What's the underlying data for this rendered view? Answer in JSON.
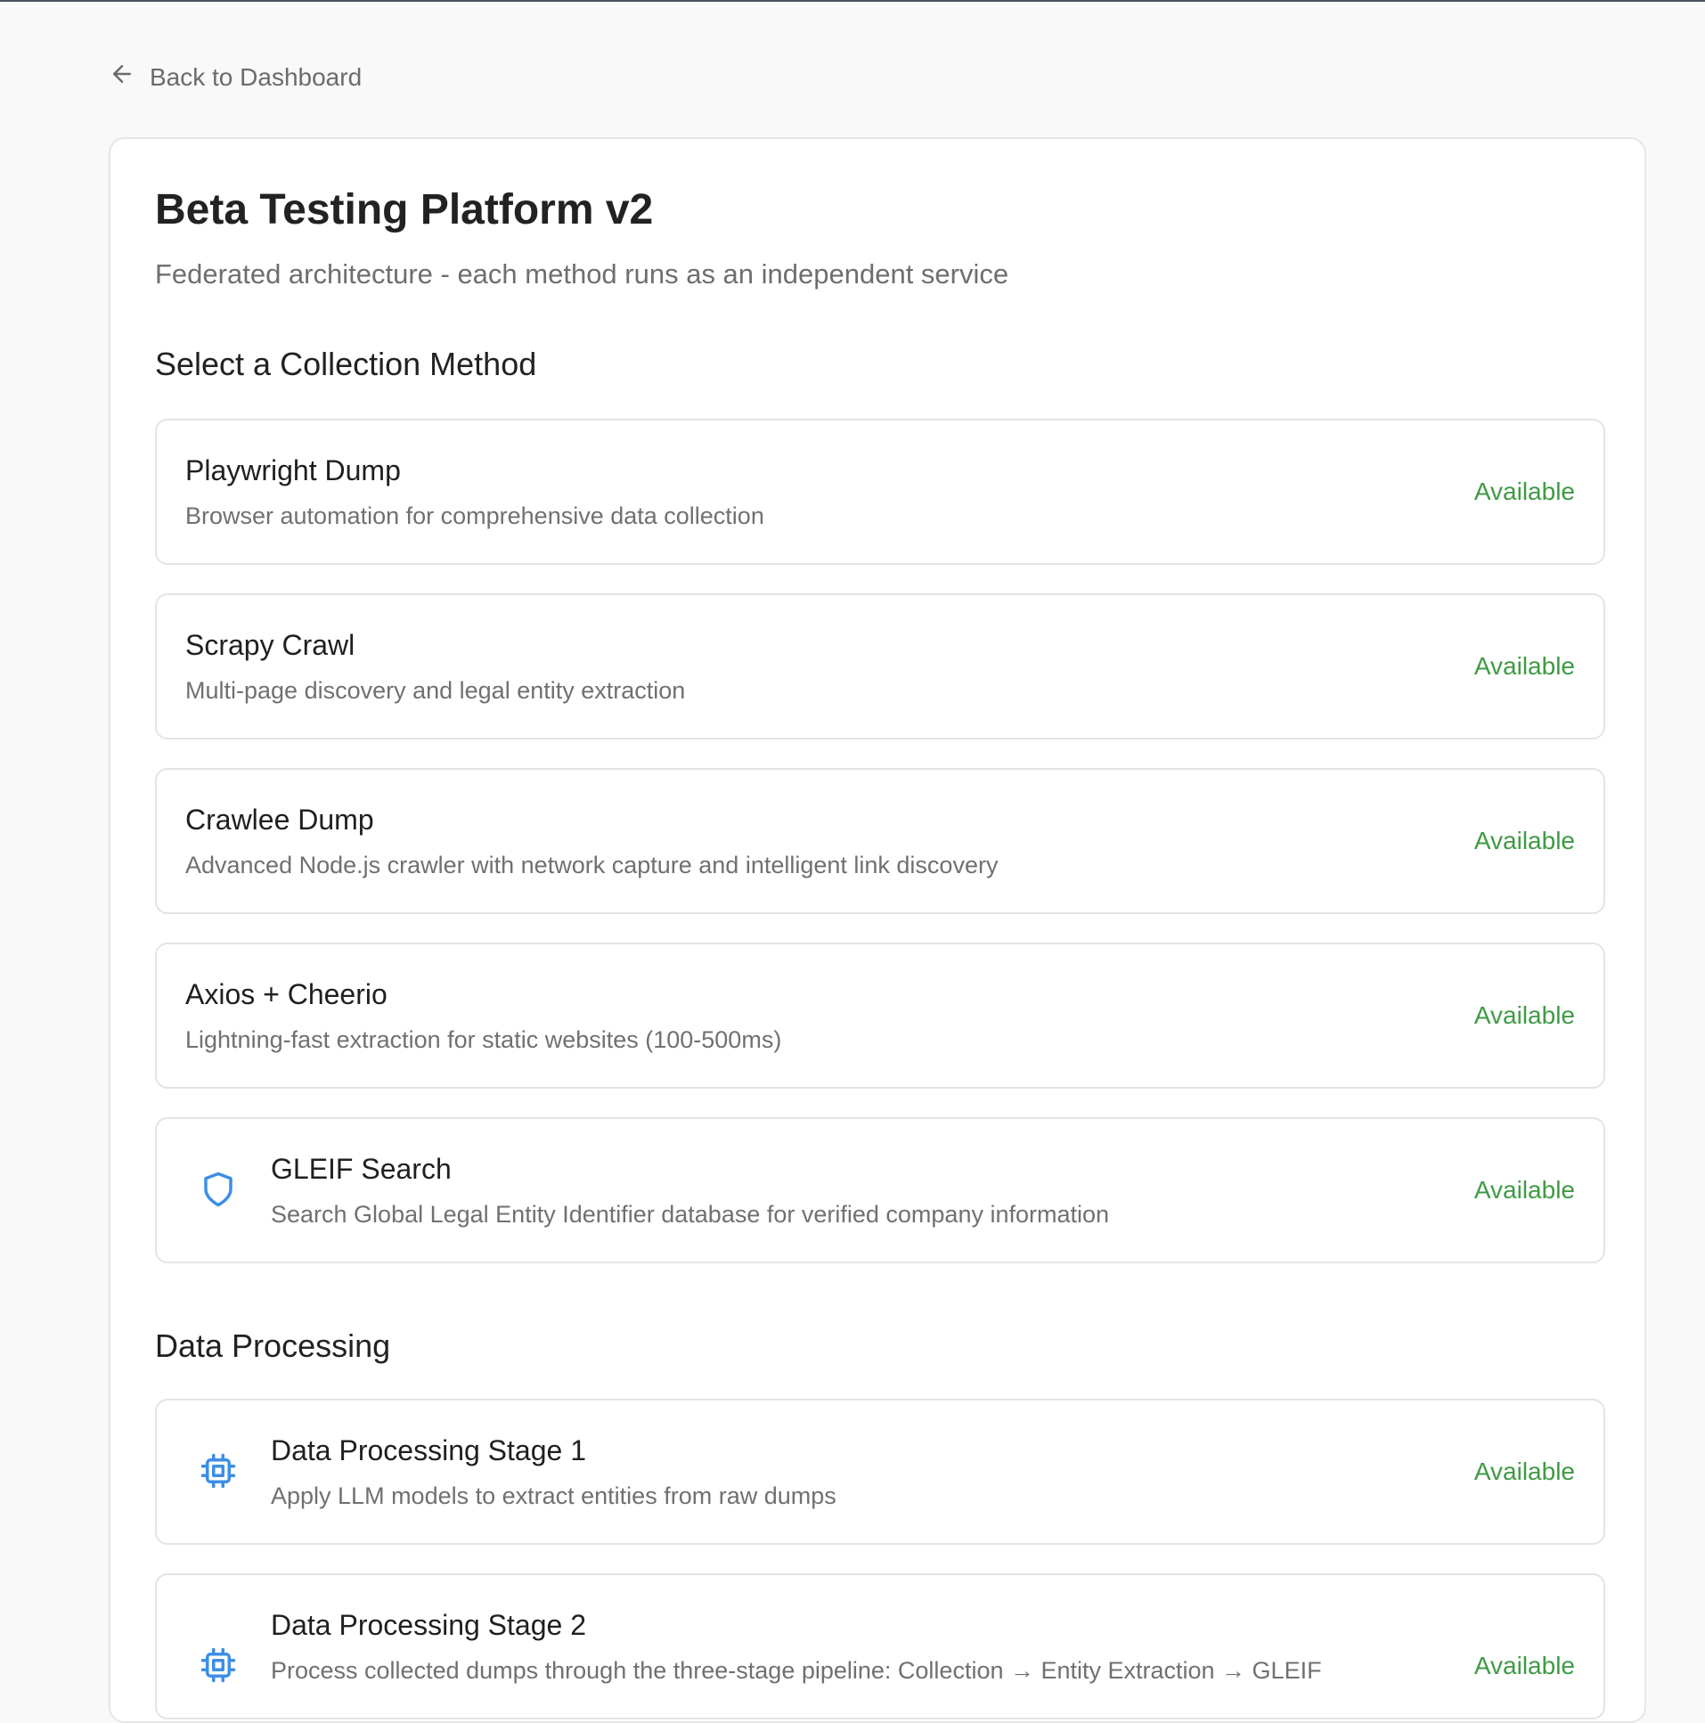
{
  "nav": {
    "back_label": "Back to Dashboard",
    "back_icon": "arrow-left-icon"
  },
  "header": {
    "title": "Beta Testing Platform v2",
    "subtitle": "Federated architecture - each method runs as an independent service"
  },
  "collection": {
    "section_title": "Select a Collection Method",
    "methods": [
      {
        "name": "Playwright Dump",
        "description": "Browser automation for comprehensive data collection",
        "status": "Available"
      },
      {
        "name": "Scrapy Crawl",
        "description": "Multi-page discovery and legal entity extraction",
        "status": "Available"
      },
      {
        "name": "Crawlee Dump",
        "description": "Advanced Node.js crawler with network capture and intelligent link discovery",
        "status": "Available"
      },
      {
        "name": "Axios + Cheerio",
        "description": "Lightning-fast extraction for static websites (100-500ms)",
        "status": "Available"
      },
      {
        "name": "GLEIF Search",
        "description": "Search Global Legal Entity Identifier database for verified company information",
        "status": "Available",
        "icon": "shield-icon"
      }
    ]
  },
  "processing": {
    "section_title": "Data Processing",
    "methods": [
      {
        "name": "Data Processing Stage 1",
        "description": "Apply LLM models to extract entities from raw dumps",
        "status": "Available",
        "icon": "cpu-icon"
      },
      {
        "name": "Data Processing Stage 2",
        "description": "Process collected dumps through the three-stage pipeline: Collection → Entity Extraction → GLEIF",
        "status": "Available",
        "icon": "cpu-icon"
      }
    ]
  },
  "colors": {
    "status_available": "#3f9a44",
    "icon_accent": "#3d8ee6"
  }
}
